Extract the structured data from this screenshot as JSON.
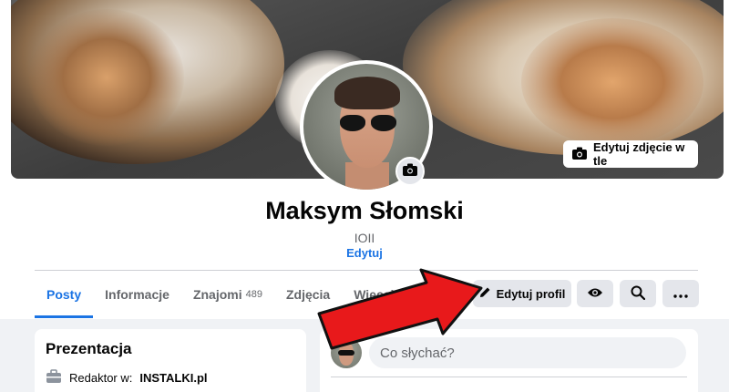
{
  "cover": {
    "edit_button_label": "Edytuj zdjęcie w tle",
    "camera_icon": "camera-icon"
  },
  "profile": {
    "name": "Maksym Słomski",
    "nickname": "IOII",
    "edit_link": "Edytuj",
    "avatar_camera_icon": "camera-icon"
  },
  "tabs": [
    {
      "label": "Posty",
      "count": "",
      "active": true
    },
    {
      "label": "Informacje",
      "count": ""
    },
    {
      "label": "Znajomi",
      "count": "489"
    },
    {
      "label": "Zdjęcia",
      "count": ""
    },
    {
      "label": "Więcej",
      "count": ""
    }
  ],
  "actions": {
    "edit_profile_label": "Edytuj profil",
    "edit_icon": "pencil-icon",
    "view_icon": "eye-icon",
    "search_icon": "search-icon",
    "more_icon": "more-icon"
  },
  "intro": {
    "title": "Prezentacja",
    "work_prefix": "Redaktor w:",
    "work_place": "INSTALKI.pl",
    "work_icon": "briefcase-icon"
  },
  "composer": {
    "placeholder": "Co słychać?"
  },
  "colors": {
    "accent": "#1b74e4",
    "button_bg": "#e4e6eb",
    "page_bg": "#f0f2f5",
    "arrow": "#e8191b"
  }
}
